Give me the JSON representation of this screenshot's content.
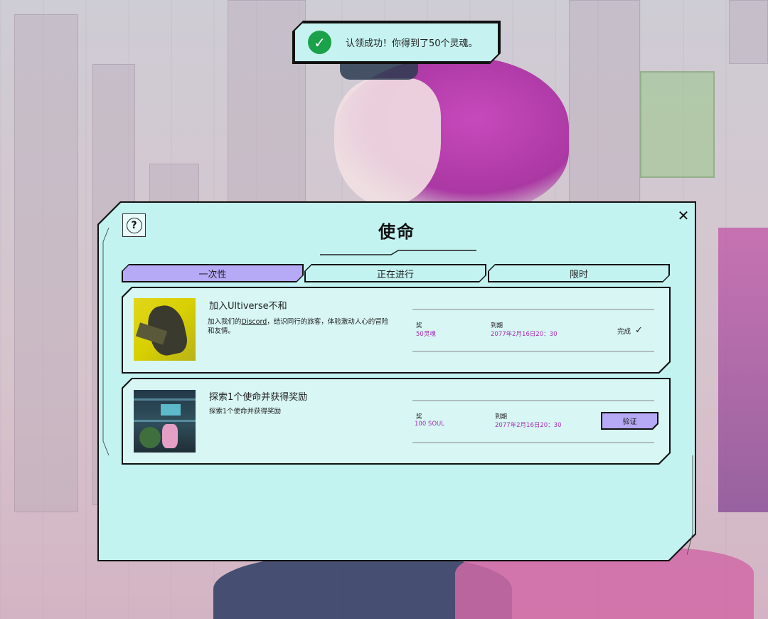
{
  "toast": {
    "message": "认领成功！你得到了50个灵魂。"
  },
  "modal": {
    "title": "使命",
    "help_symbol": "?",
    "close_symbol": "✕"
  },
  "tabs": [
    {
      "label": "一次性",
      "active": true
    },
    {
      "label": "正在进行",
      "active": false
    },
    {
      "label": "限时",
      "active": false
    }
  ],
  "missions": [
    {
      "title": "加入Ultiverse不和",
      "desc_prefix": "加入我们的",
      "desc_link": "Discord",
      "desc_suffix": "，结识同行的旅客，体验激动人心的冒险和友情。",
      "reward_label": "奖",
      "reward_value": "50灵魂",
      "expiry_label": "到期",
      "expiry_value": "2077年2月16日20：30",
      "status": "完成",
      "status_icon": "✓"
    },
    {
      "title": "探索1个使命并获得奖励",
      "desc": "探索1个使命并获得奖励",
      "reward_label": "奖",
      "reward_value": "100 SOUL",
      "expiry_label": "到期",
      "expiry_value": "2077年2月16日20：30",
      "action_label": "验证"
    }
  ],
  "colors": {
    "modal_bg": "#c3f3f1",
    "card_bg": "#d7f6f4",
    "accent_purple": "#b6a9f6",
    "value_magenta": "#a72fb8",
    "success_green": "#1aa14a"
  }
}
